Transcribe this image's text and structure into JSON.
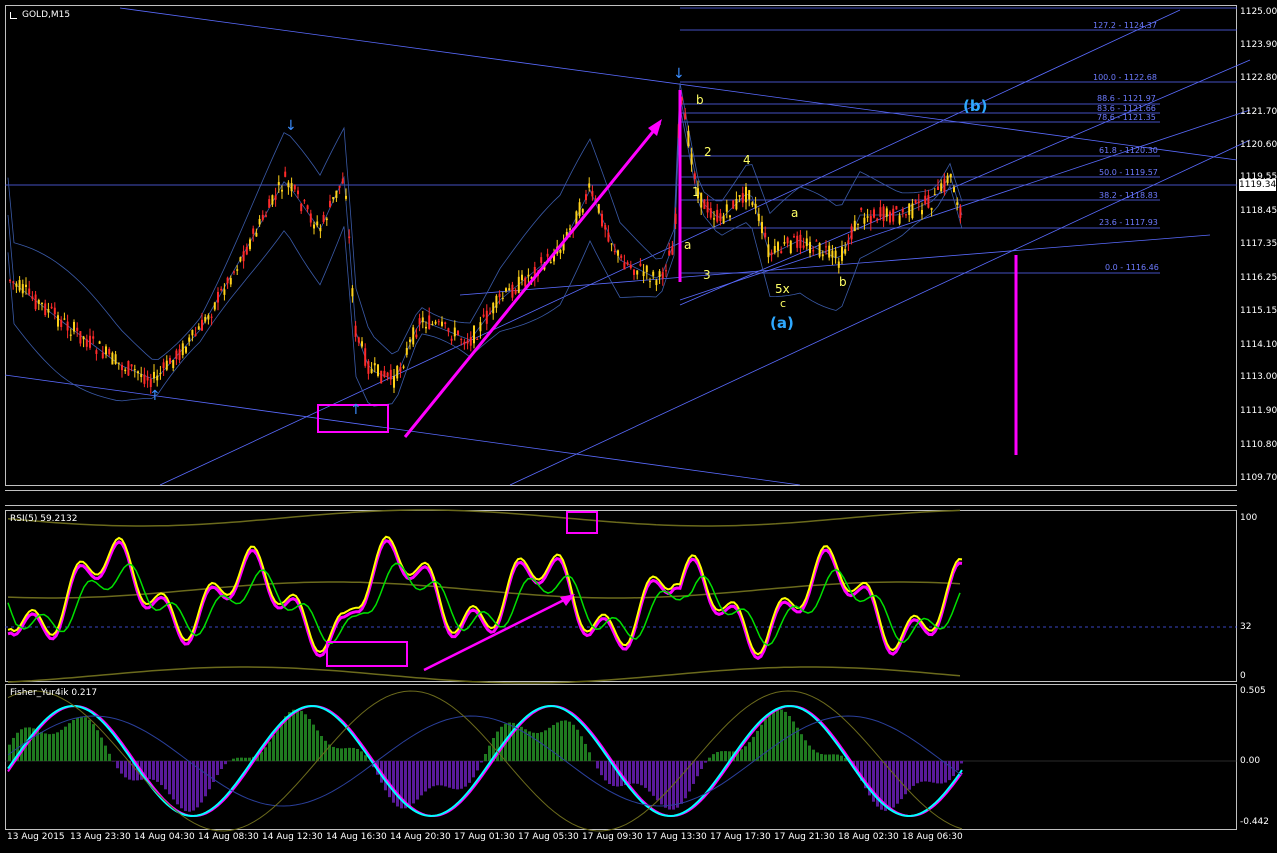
{
  "main_panel": {
    "symbol_label": "GOLD,M15",
    "current_price": "1119.34",
    "price_scale": [
      "1125.00",
      "1123.90",
      "1122.80",
      "1121.70",
      "1120.60",
      "1119.55",
      "1118.45",
      "1117.35",
      "1116.25",
      "1115.15",
      "1114.10",
      "1113.00",
      "1111.90",
      "1110.80",
      "1109.70"
    ],
    "fib_levels": [
      "127.2 - 1124.37",
      "100.0 - 1122.68",
      "88.6 - 1121.97",
      "83.6 - 1121.66",
      "78.6 - 1121.35",
      "61.8 - 1120.30",
      "50.0 - 1119.57",
      "38.2 - 1118.83",
      "23.6 - 1117.93",
      "0.0 - 1116.46"
    ],
    "wave_labels": {
      "b_top": "b",
      "one": "1",
      "two": "2",
      "three": "3",
      "four": "4",
      "a_left": "a",
      "a_right": "a",
      "b_right": "b",
      "five_x": "5x",
      "c": "c",
      "wave_a_big": "(a)",
      "wave_b_big": "(b)"
    }
  },
  "rsi_panel": {
    "label": "RSI(5) 59.2132",
    "scale": [
      "100",
      "32",
      "0"
    ]
  },
  "fisher_panel": {
    "label": "Fisher_Yur4ik 0.217",
    "scale": [
      "0.505",
      "0.00",
      "-0.442"
    ]
  },
  "time_axis": [
    "13 Aug 2015",
    "13 Aug 23:30",
    "14 Aug 04:30",
    "14 Aug 08:30",
    "14 Aug 12:30",
    "14 Aug 16:30",
    "14 Aug 20:30",
    "17 Aug 01:30",
    "17 Aug 05:30",
    "17 Aug 09:30",
    "17 Aug 13:30",
    "17 Aug 17:30",
    "17 Aug 21:30",
    "18 Aug 02:30",
    "18 Aug 06:30"
  ],
  "colors": {
    "background": "#000000",
    "bull_candle": "#ffd21a",
    "bear_candle": "#ff2a2a",
    "trendline": "#5a6bff",
    "annotation": "#ff00ff",
    "rsi_line": "#ffff00",
    "rsi_signal": "#00e000",
    "fisher_line": "#00ffff"
  }
}
